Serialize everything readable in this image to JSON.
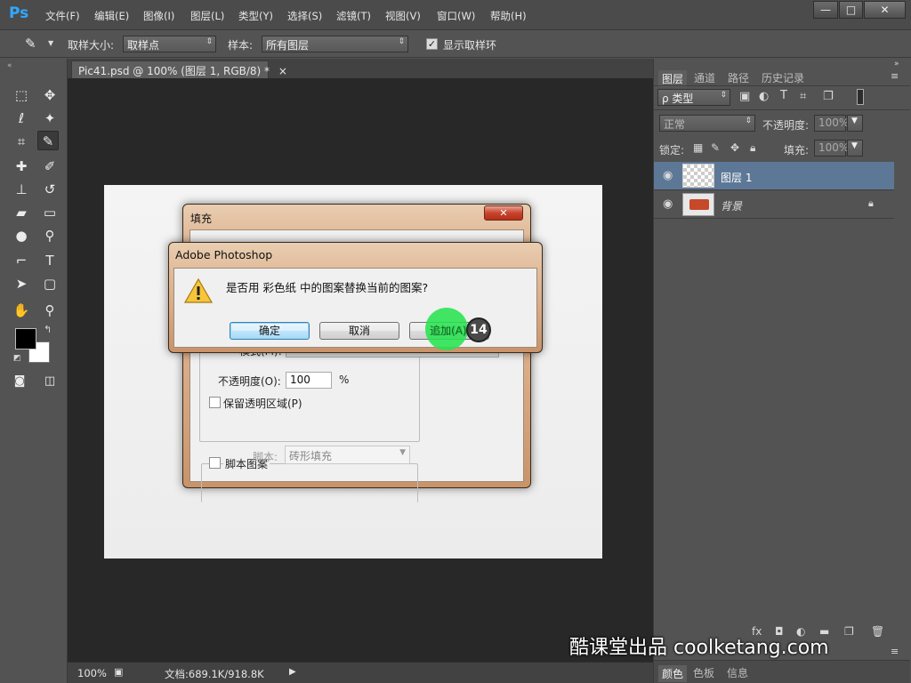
{
  "app": {
    "logo": "Ps"
  },
  "menu": [
    "文件(F)",
    "编辑(E)",
    "图像(I)",
    "图层(L)",
    "类型(Y)",
    "选择(S)",
    "滤镜(T)",
    "视图(V)",
    "窗口(W)",
    "帮助(H)"
  ],
  "window_controls": {
    "minimize": "—",
    "maximize": "□",
    "close": "✕"
  },
  "options": {
    "sample_size_label": "取样大小:",
    "sample_size_value": "取样点",
    "sample_label": "样本:",
    "sample_value": "所有图层",
    "show_ring_label": "显示取样环",
    "show_ring_checked": true
  },
  "document": {
    "tab_title": "Pic41.psd @ 100% (图层 1, RGB/8) *",
    "tab_close": "×"
  },
  "status": {
    "zoom": "100%",
    "doc_info": "文档:689.1K/918.8K"
  },
  "panels": {
    "tabs": [
      "图层",
      "通道",
      "路径",
      "历史记录"
    ],
    "filter_label": "ρ 类型",
    "blend_mode": "正常",
    "opacity_label": "不透明度:",
    "opacity_value": "100%",
    "lock_label": "锁定:",
    "fill_label": "填充:",
    "fill_value": "100%",
    "layers": [
      {
        "name": "图层 1",
        "selected": true
      },
      {
        "name": "背景",
        "selected": false,
        "locked": true
      }
    ],
    "bottom_tabs": [
      "颜色",
      "色板",
      "信息"
    ]
  },
  "fill_dialog": {
    "title": "填充",
    "close": "✕",
    "mode_label": "模式(M):",
    "opacity_label": "不透明度(O):",
    "opacity_value": "100",
    "opacity_unit": "%",
    "preserve_label": "保留透明区域(P)",
    "script_label": "脚本图案",
    "script_field_label": "脚本:",
    "script_value": "砖形填充"
  },
  "alert": {
    "title": "Adobe Photoshop",
    "message": "是否用 彩色纸 中的图案替换当前的图案?",
    "ok": "确定",
    "cancel": "取消",
    "append": "追加(A)"
  },
  "step_badge": "14",
  "watermark": "酷课堂出品 coolketang.com",
  "colors": {
    "accent": "#31a8ff",
    "highlight": "#2ee05a",
    "selected_layer": "#5d7896"
  }
}
